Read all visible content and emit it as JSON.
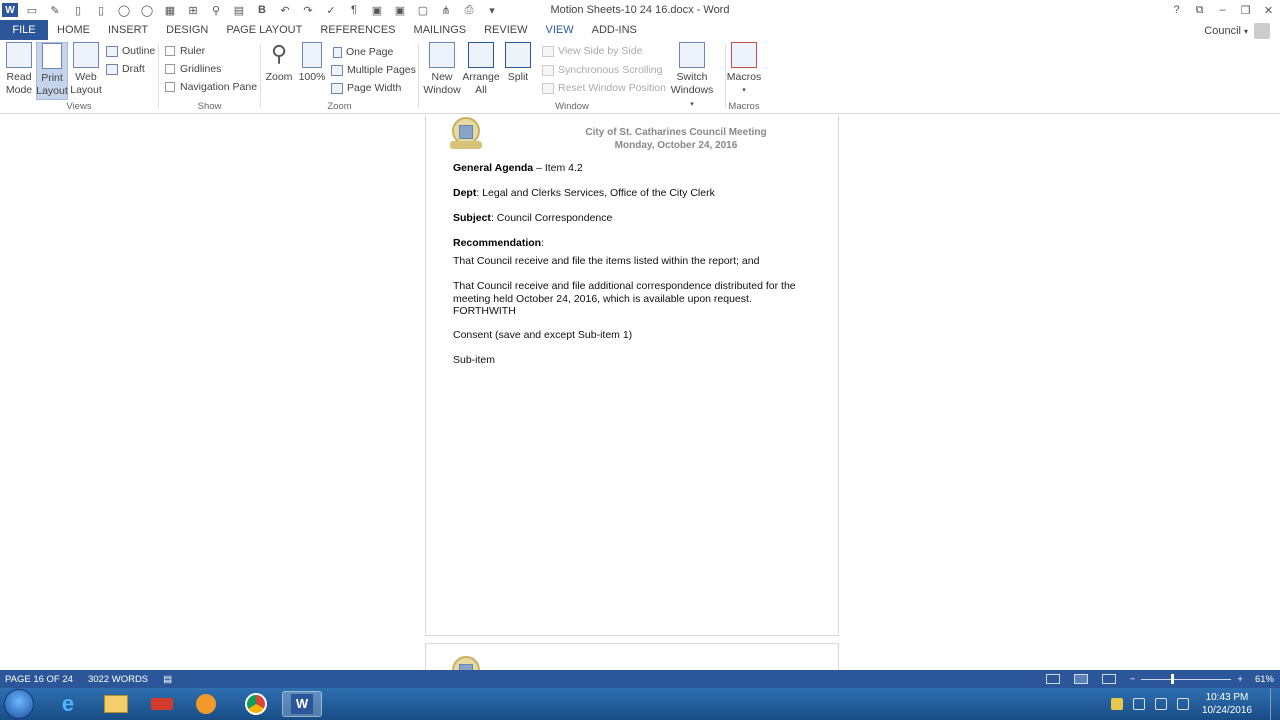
{
  "title_bar": {
    "title": "Motion Sheets-10 24 16.docx - Word",
    "qat_icons": [
      "word-icon",
      "open-icon",
      "format-painter-icon",
      "new-icon",
      "new-doc-icon",
      "circle-icon",
      "circle2-icon",
      "table-icon",
      "insert-icon",
      "find-icon",
      "paste-icon",
      "bold-icon",
      "undo-icon",
      "redo-icon",
      "spelling-icon",
      "paragraph-icon",
      "save-as-icon",
      "save-icon",
      "print-preview-icon",
      "tree-icon",
      "print-icon",
      "customize-icon"
    ],
    "controls": [
      "?",
      "⧉",
      "–",
      "❐",
      "✕"
    ]
  },
  "tabs": [
    {
      "label": "FILE",
      "kind": "file"
    },
    {
      "label": "HOME"
    },
    {
      "label": "INSERT"
    },
    {
      "label": "DESIGN"
    },
    {
      "label": "PAGE LAYOUT"
    },
    {
      "label": "REFERENCES"
    },
    {
      "label": "MAILINGS"
    },
    {
      "label": "REVIEW"
    },
    {
      "label": "VIEW",
      "active": true
    },
    {
      "label": "ADD-INS"
    }
  ],
  "account": {
    "name": "Council"
  },
  "ribbon": {
    "views": {
      "label": "Views",
      "read_mode": [
        "Read",
        "Mode"
      ],
      "print_layout": [
        "Print",
        "Layout"
      ],
      "web_layout": [
        "Web",
        "Layout"
      ],
      "outline": "Outline",
      "draft": "Draft"
    },
    "show": {
      "label": "Show",
      "ruler": "Ruler",
      "gridlines": "Gridlines",
      "navigation_pane": "Navigation Pane"
    },
    "zoom": {
      "label": "Zoom",
      "zoom": "Zoom",
      "hundred": "100%",
      "one_page": "One Page",
      "multiple_pages": "Multiple Pages",
      "page_width": "Page Width"
    },
    "window": {
      "label": "Window",
      "new_window": [
        "New",
        "Window"
      ],
      "arrange_all": [
        "Arrange",
        "All"
      ],
      "split": "Split",
      "view_side": "View Side by Side",
      "sync_scroll": "Synchronous Scrolling",
      "reset_pos": "Reset Window Position",
      "switch": [
        "Switch",
        "Windows"
      ]
    },
    "macros": {
      "label": "Macros",
      "macros": "Macros"
    }
  },
  "document": {
    "header_line1": "City of St. Catharines Council Meeting",
    "header_line2": "Monday, October 24, 2016",
    "agenda_label": "General Agenda",
    "agenda_value": "– Item 4.2",
    "dept_label": "Dept",
    "dept_value": ": Legal and Clerks Services, Office of the City Clerk",
    "subject_label": "Subject",
    "subject_value": ": Council Correspondence",
    "recommendation_label": "Recommendation",
    "recommendation_colon": ":",
    "rec1": "That Council receive and file the items listed within the report; and",
    "rec2_line1": "That Council receive and file additional correspondence distributed for the",
    "rec2_line2": "meeting held October 24, 2016, which is available upon request.",
    "rec2_line3": "FORTHWITH",
    "consent": "Consent (save and except Sub-item 1)",
    "subitem": "Sub-item"
  },
  "status": {
    "page": "PAGE 16 OF 24",
    "words": "3022 WORDS",
    "zoom": "61%",
    "zoom_value": 0.61
  },
  "taskbar": {
    "time": "10:43 PM",
    "date": "10/24/2016"
  },
  "colors": {
    "accent": "#2b579a",
    "taskbar": "#1f5a98"
  }
}
